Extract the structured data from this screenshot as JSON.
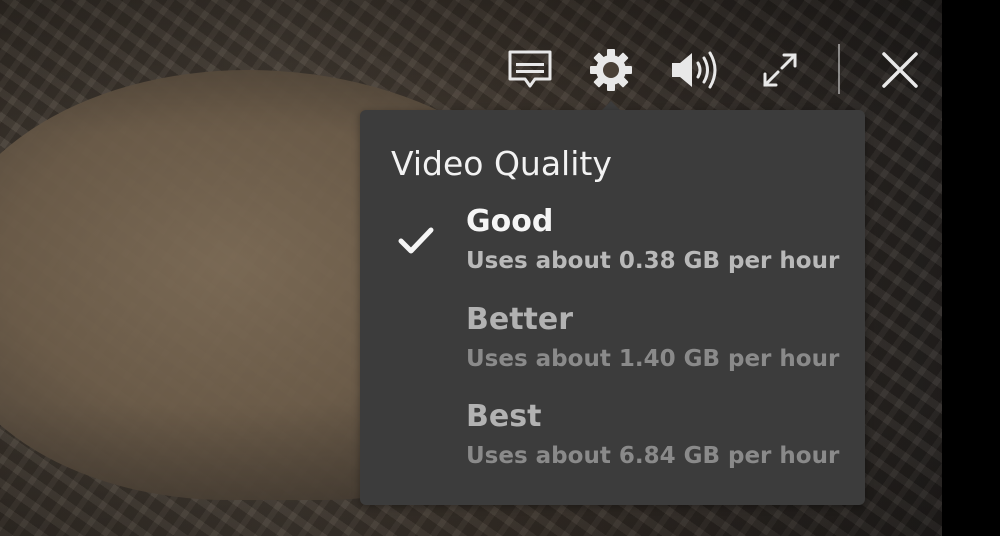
{
  "controls": {
    "icons": [
      "subtitles-icon",
      "gear-icon",
      "volume-icon",
      "fullscreen-icon",
      "close-icon"
    ]
  },
  "video_quality": {
    "title": "Video Quality",
    "options": [
      {
        "label": "Good",
        "description": "Uses about 0.38 GB per hour",
        "selected": true
      },
      {
        "label": "Better",
        "description": "Uses about 1.40 GB per hour",
        "selected": false
      },
      {
        "label": "Best",
        "description": "Uses about 6.84 GB per hour",
        "selected": false
      }
    ]
  },
  "colors": {
    "panel_background": "#3c3c3c",
    "selected_text": "#f5f5f5",
    "unselected_text": "#b2b2b2"
  }
}
